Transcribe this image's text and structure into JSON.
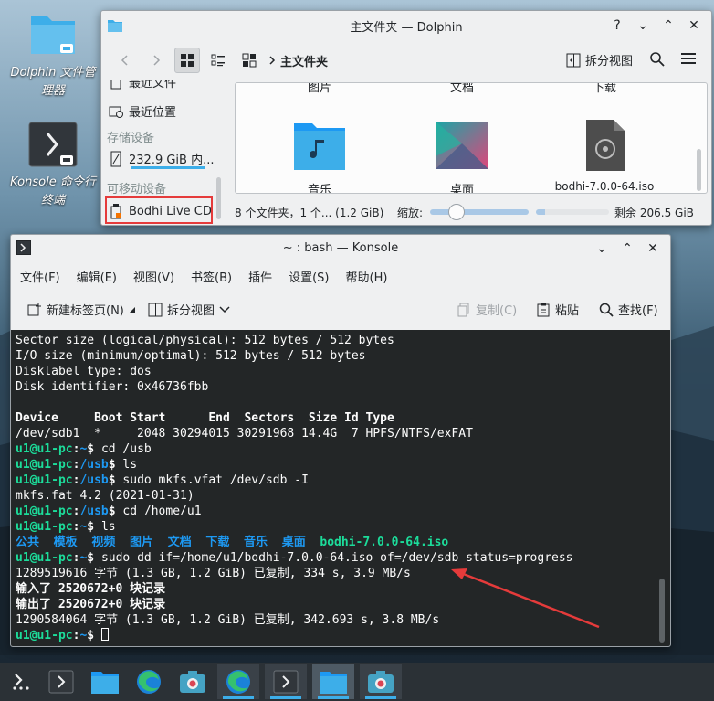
{
  "colors": {
    "accent": "#3daee9",
    "terminal_bg": "#232627",
    "prompt_green": "#1cdc9a",
    "path_blue": "#1d99f3",
    "highlight_red": "#e53b3b"
  },
  "desktop": {
    "icons": [
      {
        "label": "Dolphin 文件管理器",
        "icon": "folder-icon"
      },
      {
        "label": "Konsole 命令行终端",
        "icon": "terminal-icon"
      }
    ]
  },
  "dolphin": {
    "title": "主文件夹 — Dolphin",
    "window_buttons": [
      "?",
      "⌄",
      "⌃",
      "✕"
    ],
    "breadcrumb": "主文件夹",
    "split_view_label": "拆分视图",
    "places": {
      "recent_files": "最近文件",
      "recent_locations": "最近位置",
      "storage_heading": "存储设备",
      "disk_label": "232.9 GiB 内...",
      "removable_heading": "可移动设备",
      "removable_item": "Bodhi Live CD"
    },
    "files": [
      {
        "name": "图片",
        "icon": "pictures-folder-icon"
      },
      {
        "name": "文档",
        "icon": "documents-folder-icon"
      },
      {
        "name": "下载",
        "icon": "downloads-folder-icon"
      },
      {
        "name": "音乐",
        "icon": "music-folder-icon"
      },
      {
        "name": "桌面",
        "icon": "desktop-folder-icon"
      },
      {
        "name": "bodhi-7.0.0-64.iso",
        "icon": "disc-image-icon"
      }
    ],
    "status": {
      "summary": "8 个文件夹，1 个... (1.2 GiB)",
      "zoom_label": "缩放:",
      "zoom_level": 0.22,
      "free_space": "剩余 206.5 GiB",
      "used_fraction": 0.12
    }
  },
  "konsole": {
    "title": "~ : bash — Konsole",
    "menu": [
      "文件(F)",
      "编辑(E)",
      "视图(V)",
      "书签(B)",
      "插件",
      "设置(S)",
      "帮助(H)"
    ],
    "toolbar": {
      "new_tab": "新建标签页(N)",
      "split_view": "拆分视图",
      "copy": "复制(C)",
      "paste": "粘贴",
      "find": "查找(F)"
    },
    "terminal": {
      "l1": "Sector size (logical/physical): 512 bytes / 512 bytes",
      "l2": "I/O size (minimum/optimal): 512 bytes / 512 bytes",
      "l3": "Disklabel type: dos",
      "l4": "Disk identifier: 0x46736fbb",
      "l5": "",
      "l6": "Device     Boot Start      End  Sectors  Size Id Type",
      "l7": "/dev/sdb1  *     2048 30294015 30291968 14.4G  7 HPFS/NTFS/exFAT",
      "user": "u1@u1-pc",
      "colon": ":",
      "home": "~",
      "usb": "/usb",
      "tilde_usb": "~/usb",
      "dollar": "$ ",
      "c1": "cd /usb",
      "c2": "ls",
      "c3": "sudo mkfs.vfat /dev/sdb -I",
      "o3": "mkfs.fat 4.2 (2021-01-31)",
      "c4": "cd /home/u1",
      "c5": "ls",
      "ls_items": [
        "公共",
        "模板",
        "视频",
        "图片",
        "文档",
        "下载",
        "音乐",
        "桌面"
      ],
      "ls_iso": "bodhi-7.0.0-64.iso",
      "c6": "sudo dd if=/home/u1/bodhi-7.0.0-64.iso of=/dev/sdb status=progress",
      "o6a": "1289519616 字节 (1.3 GB, 1.2 GiB) 已复制, 334 s, 3.9 MB/s",
      "o6b": "输入了 2520672+0 块记录",
      "o6c": "输出了 2520672+0 块记录",
      "o6d": "1290584064 字节 (1.3 GB, 1.2 GiB) 已复制, 342.693 s, 3.8 MB/s"
    }
  },
  "taskbar": {
    "items": [
      {
        "name": "launcher-icon"
      },
      {
        "name": "konsole-icon"
      },
      {
        "name": "dolphin-icon"
      },
      {
        "name": "edge-icon"
      },
      {
        "name": "screenshot-icon"
      },
      {
        "name": "edge-icon"
      },
      {
        "name": "konsole-icon"
      },
      {
        "name": "dolphin-icon"
      },
      {
        "name": "screenshot-icon"
      }
    ]
  }
}
